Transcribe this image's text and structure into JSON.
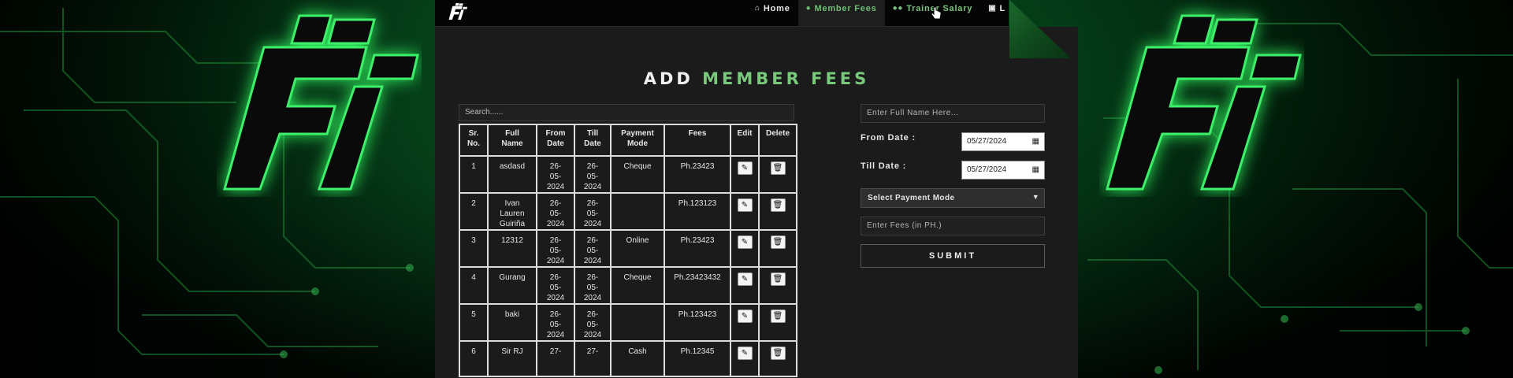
{
  "nav": {
    "items": [
      {
        "label": "Home",
        "icon": "home-icon"
      },
      {
        "label": "Member Fees",
        "icon": "user-icon"
      },
      {
        "label": "Trainer Salary",
        "icon": "users-icon"
      },
      {
        "label": "L",
        "icon": "lock-icon"
      }
    ]
  },
  "page": {
    "title_white": "ADD",
    "title_green": "MEMBER FEES",
    "accent": "#79c97d"
  },
  "search": {
    "placeholder": "Search......"
  },
  "table": {
    "headers": [
      "Sr.\nNo.",
      "Full\nName",
      "From\nDate",
      "Till\nDate",
      "Payment\nMode",
      "Fees",
      "Edit",
      "Delete"
    ],
    "rows": [
      {
        "sr": "1",
        "name": "asdasd",
        "from": "26-\n05-\n2024",
        "till": "26-\n05-\n2024",
        "mode": "Cheque",
        "fees": "Ph.23423"
      },
      {
        "sr": "2",
        "name": "Ivan\nLauren\nGuiriña",
        "from": "26-\n05-\n2024",
        "till": "26-\n05-\n2024",
        "mode": "",
        "fees": "Ph.123123"
      },
      {
        "sr": "3",
        "name": "12312",
        "from": "26-\n05-\n2024",
        "till": "26-\n05-\n2024",
        "mode": "Online",
        "fees": "Ph.23423"
      },
      {
        "sr": "4",
        "name": "Gurang",
        "from": "26-\n05-\n2024",
        "till": "26-\n05-\n2024",
        "mode": "Cheque",
        "fees": "Ph.23423432"
      },
      {
        "sr": "5",
        "name": "baki",
        "from": "26-\n05-\n2024",
        "till": "26-\n05-\n2024",
        "mode": "",
        "fees": "Ph.123423"
      },
      {
        "sr": "6",
        "name": "Sir RJ",
        "from": "27-",
        "till": "27-",
        "mode": "Cash",
        "fees": "Ph.12345"
      }
    ]
  },
  "form": {
    "name_placeholder": "Enter Full Name Here...",
    "from_label": "From Date :",
    "from_value": "05/27/2024",
    "till_label": "Till Date :",
    "till_value": "05/27/2024",
    "payment_select": "Select Payment Mode",
    "fees_placeholder": "Enter Fees (in PH.)",
    "submit_label": "SUBMIT"
  }
}
